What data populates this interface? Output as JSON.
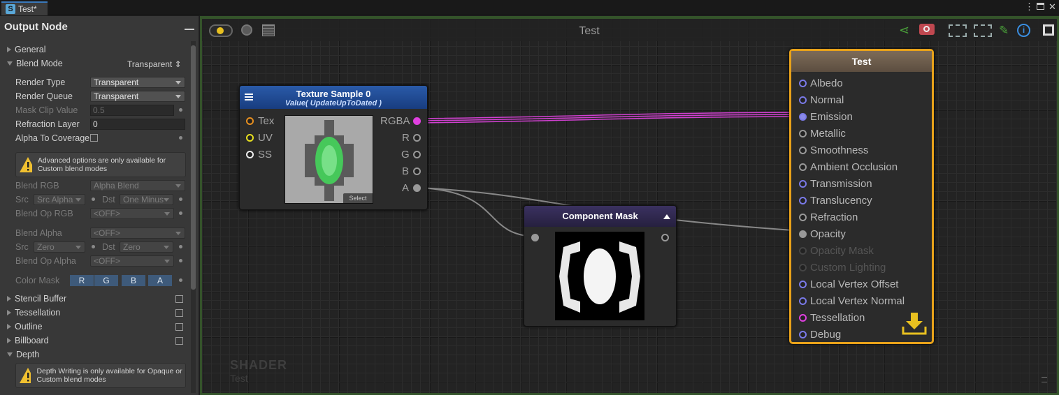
{
  "window": {
    "tab_title": "Test*",
    "tab_icon": "S",
    "menu_icon": "kebab-icon",
    "restore_icon": "restore-icon",
    "close_icon": "close-icon"
  },
  "sidebar": {
    "title": "Output Node",
    "sections": {
      "general": "General",
      "blend_mode": "Blend Mode",
      "blend_mode_value": "Transparent",
      "stencil": "Stencil Buffer",
      "tessellation": "Tessellation",
      "outline": "Outline",
      "billboard": "Billboard",
      "depth": "Depth"
    },
    "props": {
      "render_type": {
        "label": "Render Type",
        "value": "Transparent"
      },
      "render_queue": {
        "label": "Render Queue",
        "value": "Transparent"
      },
      "mask_clip": {
        "label": "Mask Clip Value",
        "value": "0.5"
      },
      "refraction_layer": {
        "label": "Refraction Layer",
        "value": "0"
      },
      "alpha_to_coverage": {
        "label": "Alpha To Coverage"
      },
      "blend_rgb": {
        "label": "Blend RGB",
        "value": "Alpha Blend"
      },
      "src_rgb": {
        "label": "Src",
        "value": "Src Alpha"
      },
      "dst_rgb": {
        "label": "Dst",
        "value": "One Minus"
      },
      "blend_op_rgb": {
        "label": "Blend Op RGB",
        "value": "<OFF>"
      },
      "blend_alpha": {
        "label": "Blend Alpha",
        "value": "<OFF>"
      },
      "src_alpha": {
        "label": "Src",
        "value": "Zero"
      },
      "dst_alpha": {
        "label": "Dst",
        "value": "Zero"
      },
      "blend_op_alpha": {
        "label": "Blend Op Alpha",
        "value": "<OFF>"
      },
      "color_mask": {
        "label": "Color Mask",
        "channels": [
          "R",
          "G",
          "B",
          "A"
        ]
      }
    },
    "help": {
      "advanced": "Advanced options are only available for Custom blend modes",
      "depth": "Depth Writing is only available for Opaque or Custom blend modes"
    }
  },
  "graph": {
    "title": "Test",
    "watermark": {
      "line1": "SHADER",
      "line2": "Test"
    },
    "toolbar_icons": [
      "live-mode-icon",
      "clean-icon",
      "open-editor-icon",
      "share-icon",
      "screenshot-icon",
      "focus-icon",
      "center-icon",
      "maximize-icon",
      "brush-icon",
      "info-icon",
      "fullscreen-icon"
    ],
    "texture_node": {
      "title": "Texture Sample 0",
      "subtitle": "Value( UpdateUpToDated )",
      "inputs": [
        "Tex",
        "UV",
        "SS"
      ],
      "outputs": [
        "RGBA",
        "R",
        "G",
        "B",
        "A"
      ],
      "select_label": "Select"
    },
    "mask_node": {
      "title": "Component Mask"
    },
    "output_node": {
      "title": "Test",
      "ports": [
        "Albedo",
        "Normal",
        "Emission",
        "Metallic",
        "Smoothness",
        "Ambient Occlusion",
        "Transmission",
        "Translucency",
        "Refraction",
        "Opacity",
        "Opacity Mask",
        "Custom Lighting",
        "Local Vertex Offset",
        "Local Vertex Normal",
        "Tessellation",
        "Debug"
      ]
    },
    "colors": {
      "accent_output": "#e8a21a",
      "rgba_wire": "#e040e0",
      "port_blue": "#7a7ae8",
      "port_pink": "#e040e0"
    }
  }
}
